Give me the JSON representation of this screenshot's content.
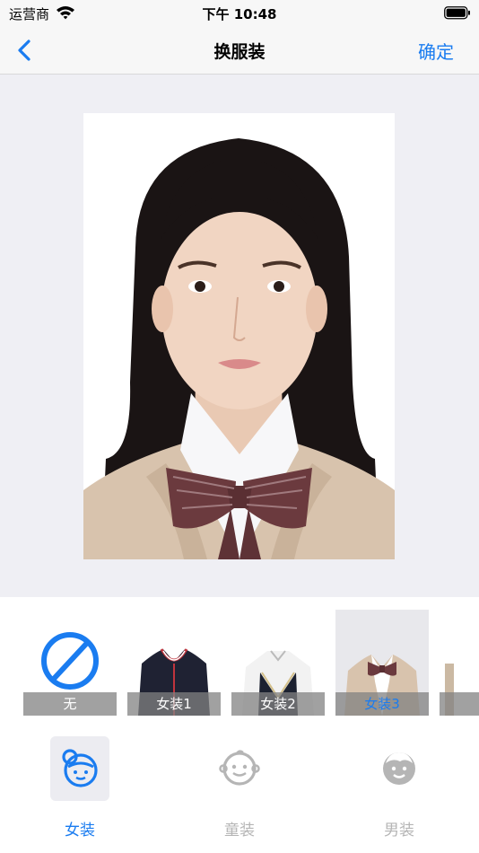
{
  "status_bar": {
    "carrier": "运营商",
    "time": "下午 10:48"
  },
  "nav": {
    "title": "换服装",
    "back_icon": "chevron-left-icon",
    "confirm_label": "确定"
  },
  "outfits": [
    {
      "label": "无",
      "icon": "no-entry-icon"
    },
    {
      "label": "女装1"
    },
    {
      "label": "女装2"
    },
    {
      "label": "女装3",
      "selected": true
    }
  ],
  "tabs": [
    {
      "label": "女装",
      "icon": "girl-face-icon",
      "active": true
    },
    {
      "label": "童装",
      "icon": "child-face-icon"
    },
    {
      "label": "男装",
      "icon": "boy-face-icon"
    }
  ],
  "colors": {
    "accent": "#1a7cf0",
    "inactive": "#b5b5b5",
    "canvas_bg": "#efeff4"
  }
}
